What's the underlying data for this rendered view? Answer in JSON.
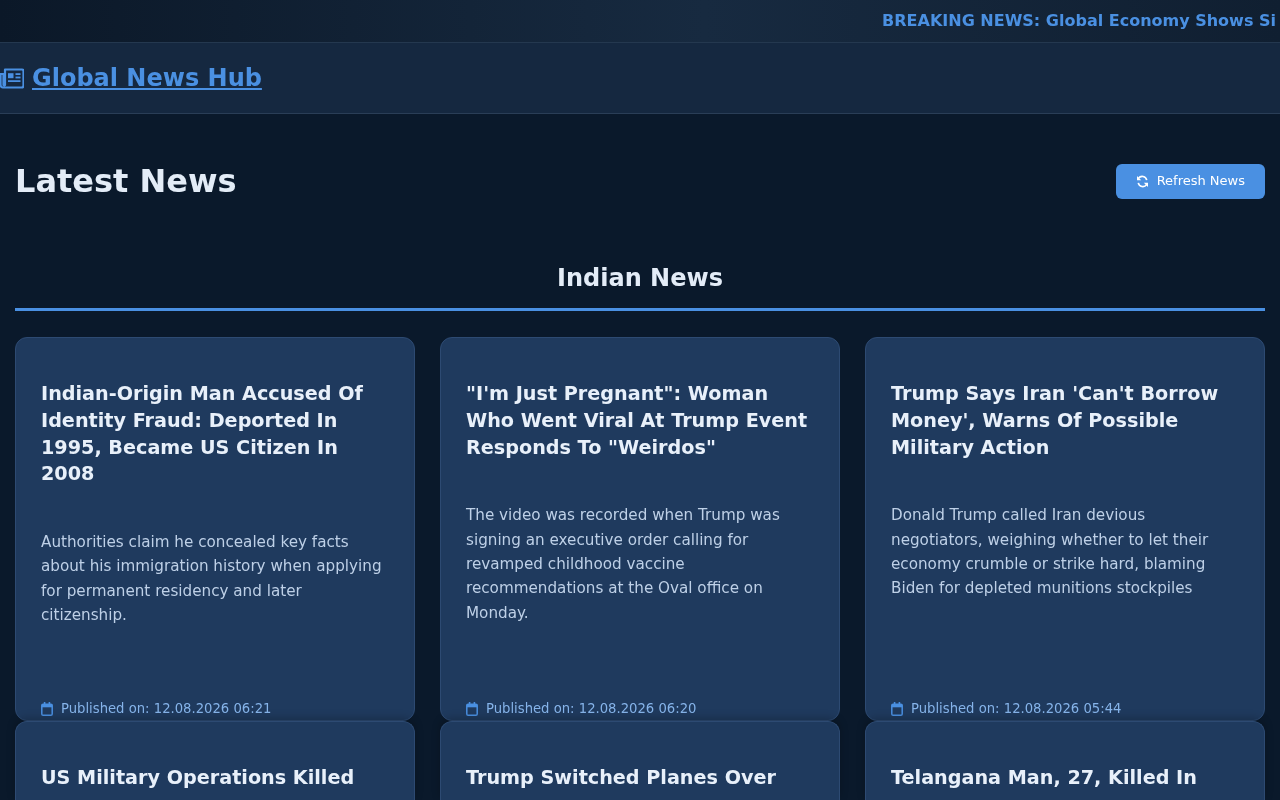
{
  "ticker": {
    "text": "BREAKING NEWS: Global Economy Shows Si"
  },
  "navbar": {
    "brand": "Global News Hub"
  },
  "page_title": "Latest News",
  "refresh_button": {
    "label": "Refresh News"
  },
  "section": {
    "title": "Indian News",
    "articles": [
      {
        "title": "Indian-Origin Man Accused Of Identity Fraud: Deported In 1995, Became US Citizen In 2008",
        "description": "Authorities claim he concealed key facts about his immigration history when applying for permanent residency and later citizenship.",
        "published": "Published on: 12.08.2026 06:21"
      },
      {
        "title": "\"I'm Just Pregnant\": Woman Who Went Viral At Trump Event Responds To \"Weirdos\"",
        "description": "The video was recorded when Trump was signing an executive order calling for revamped childhood vaccine recommendations at the Oval office on Monday.",
        "published": "Published on: 12.08.2026 06:20"
      },
      {
        "title": "Trump Says Iran 'Can't Borrow Money', Warns Of Possible Military Action",
        "description": "Donald Trump called Iran devious negotiators, weighing whether to let their economy crumble or strike hard, blaming Biden for depleted munitions stockpiles",
        "published": "Published on: 12.08.2026 05:44"
      },
      {
        "title": "US Military Operations Killed"
      },
      {
        "title": "Trump Switched Planes Over"
      },
      {
        "title": "Telangana Man, 27, Killed In"
      }
    ]
  }
}
